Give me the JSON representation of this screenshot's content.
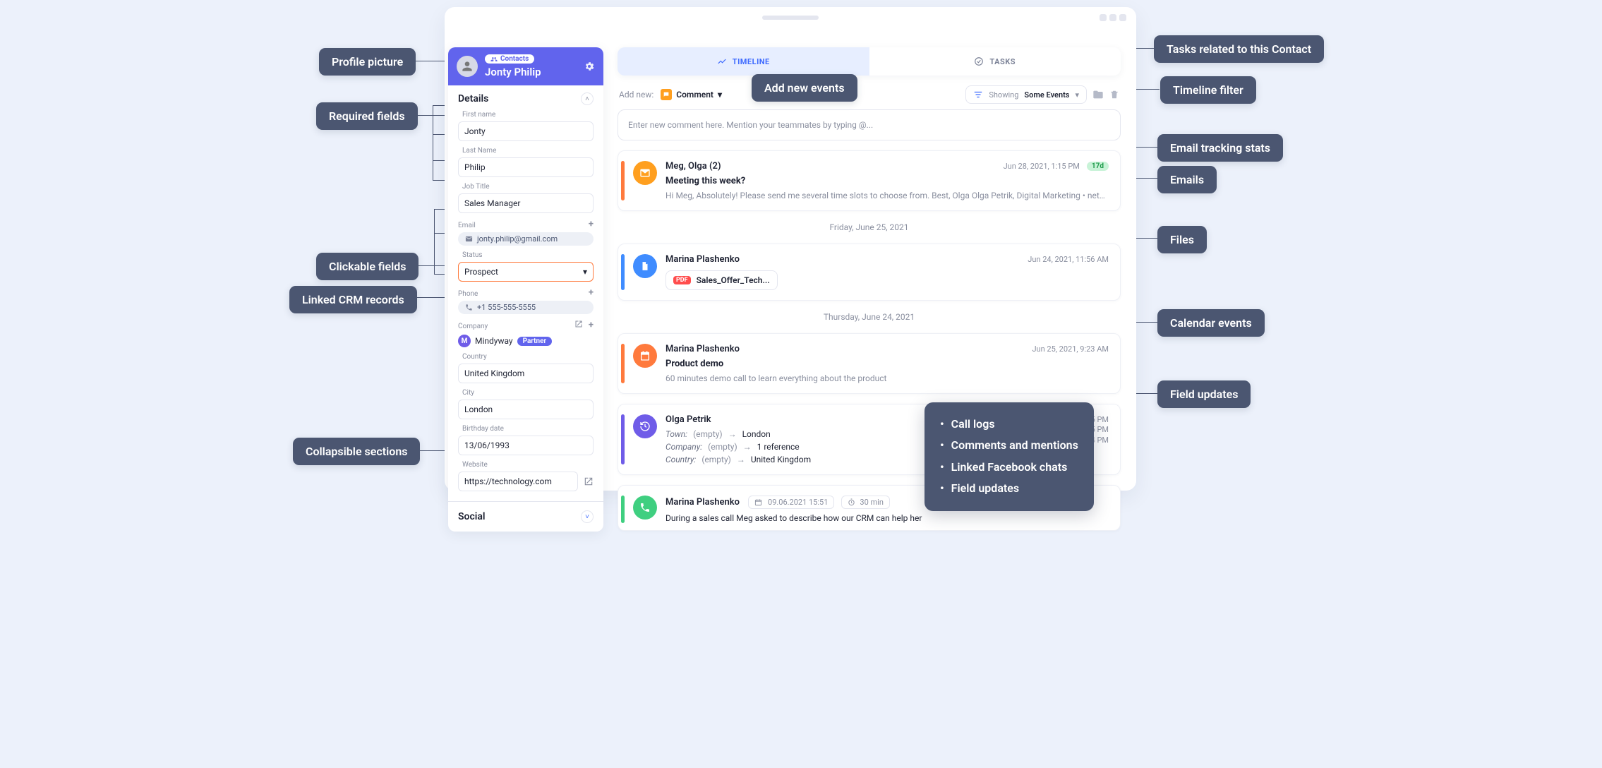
{
  "header": {
    "contacts_pill": "Contacts",
    "name": "Jonty Philip"
  },
  "details": {
    "title": "Details",
    "first_name_label": "First name",
    "first_name": "Jonty",
    "last_name_label": "Last Name",
    "last_name": "Philip",
    "job_title_label": "Job Title",
    "job_title": "Sales Manager",
    "email_label": "Email",
    "email": "jonty.philip@gmail.com",
    "status_label": "Status",
    "status": "Prospect",
    "phone_label": "Phone",
    "phone": "+1 555-555-5555",
    "company_label": "Company",
    "company_initial": "M",
    "company": "Mindyway",
    "company_tag": "Partner",
    "country_label": "Country",
    "country": "United Kingdom",
    "city_label": "City",
    "city": "London",
    "birthday_label": "Birthday date",
    "birthday": "13/06/1993",
    "website_label": "Website",
    "website": "https://technology.com"
  },
  "social_title": "Social",
  "tabs": {
    "timeline": "TIMELINE",
    "tasks": "TASKS"
  },
  "toolbar": {
    "add_new": "Add new:",
    "comment": "Comment",
    "showing": "Showing",
    "some_events": "Some Events"
  },
  "comment_placeholder": "Enter new comment here. Mention your teammates by typing @...",
  "timeline": {
    "e1": {
      "author": "Meg, Olga (2)",
      "time": "Jun 28, 2021, 1:15 PM",
      "badge": "17d",
      "subject": "Meeting this week?",
      "snippet": "Hi Meg, Absolutely! Please send me several time slots to choose from. Best, Olga Olga Petrik, Digital Marketing • nethunt.co..."
    },
    "sep1": "Friday, June 25, 2021",
    "e2": {
      "author": "Marina Plashenko",
      "time": "Jun 24, 2021, 11:56 AM",
      "file": "Sales_Offer_Tech..."
    },
    "sep2": "Thursday, June 24, 2021",
    "e3": {
      "author": "Marina Plashenko",
      "time": "Jun 25, 2021, 9:23 AM",
      "subject": "Product demo",
      "snippet": "60 minutes demo call to learn everything about the product"
    },
    "e4": {
      "author": "Olga Petrik",
      "time": "Jun 25, 2021, 4:05 PM",
      "empty": "(empty)",
      "arrow": "→",
      "f1": "Town:",
      "v1": "London",
      "f2": "Company:",
      "v2": "1 reference",
      "f3": "Country:",
      "v3": "United Kingdom",
      "t1": "1:15 PM",
      "t2": "1:14 PM"
    },
    "e5": {
      "author": "Marina Plashenko",
      "date": "09.06.2021 15:51",
      "dur": "30 min",
      "snippet": "During a sales call Meg asked to describe how our CRM can help her"
    }
  },
  "popover": {
    "i1": "Call logs",
    "i2": "Comments and mentions",
    "i3": "Linked Facebook chats",
    "i4": "Field updates"
  },
  "ann": {
    "profile": "Profile picture",
    "required": "Required fields",
    "clickable": "Clickable fields",
    "linked": "Linked CRM records",
    "collapsible": "Collapsible sections",
    "tasks": "Tasks related to this Contact",
    "filter": "Timeline filter",
    "addnew": "Add new events",
    "etrack": "Email tracking stats",
    "emails": "Emails",
    "files": "Files",
    "calendar": "Calendar events",
    "fieldupd": "Field updates"
  }
}
